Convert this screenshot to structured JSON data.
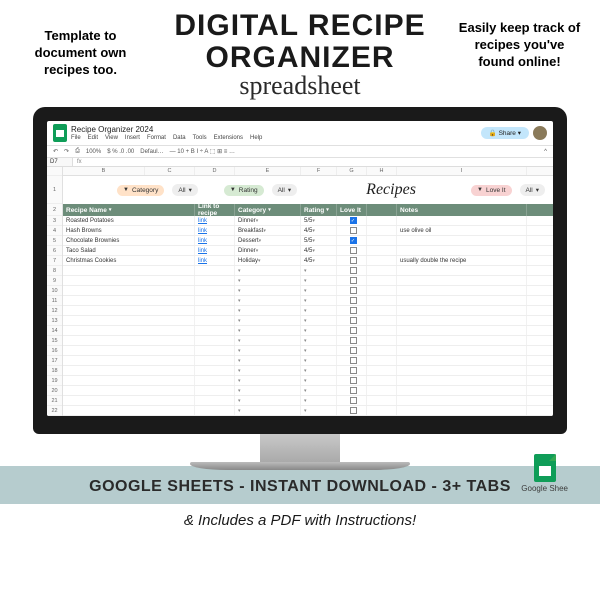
{
  "promo": {
    "left_note": "Template to document own recipes too.",
    "title_line1": "DIGITAL RECIPE",
    "title_line2": "ORGANIZER",
    "title_sub": "spreadsheet",
    "right_note": "Easily keep track of recipes you've found online!",
    "banner": "GOOGLE SHEETS  -  INSTANT DOWNLOAD  -  3+ TABS",
    "sub_banner": "& Includes a PDF with Instructions!",
    "gs_label": "Google Shee"
  },
  "sheets": {
    "doc_name": "Recipe Organizer 2024",
    "menu": [
      "File",
      "Edit",
      "View",
      "Insert",
      "Format",
      "Data",
      "Tools",
      "Extensions",
      "Help"
    ],
    "share": "Share",
    "name_box": "D7",
    "fx": "fx",
    "zoom": "100%",
    "format": "Defaul…",
    "toolbar_items": [
      "←",
      "→",
      "⎙",
      "↶",
      "↷"
    ],
    "columns": [
      "B",
      "C",
      "D",
      "E",
      "F",
      "G",
      "H",
      "I"
    ],
    "title": "Recipes",
    "filters": {
      "category_label": "Category",
      "category_val": "All",
      "rating_label": "Rating",
      "rating_val": "All",
      "love_label": "Love It",
      "love_val": "All"
    },
    "headers": {
      "name": "Recipe Name",
      "link": "Link to recipe",
      "category": "Category",
      "rating": "Rating",
      "love": "Love It",
      "notes": "Notes"
    },
    "rows": [
      {
        "name": "Roasted Potatoes",
        "link": "link",
        "category": "Dinner",
        "rating": "5/5",
        "love": true,
        "notes": ""
      },
      {
        "name": "Hash Browns",
        "link": "link",
        "category": "Breakfast",
        "rating": "4/5",
        "love": false,
        "notes": "use olive oil"
      },
      {
        "name": "Chocolate Brownies",
        "link": "link",
        "category": "Dessert",
        "rating": "5/5",
        "love": true,
        "notes": ""
      },
      {
        "name": "Taco Salad",
        "link": "link",
        "category": "Dinner",
        "rating": "4/5",
        "love": false,
        "notes": ""
      },
      {
        "name": "Christmas Cookies",
        "link": "link",
        "category": "Holiday",
        "rating": "4/5",
        "love": false,
        "notes": "usually double the recipe"
      }
    ]
  }
}
